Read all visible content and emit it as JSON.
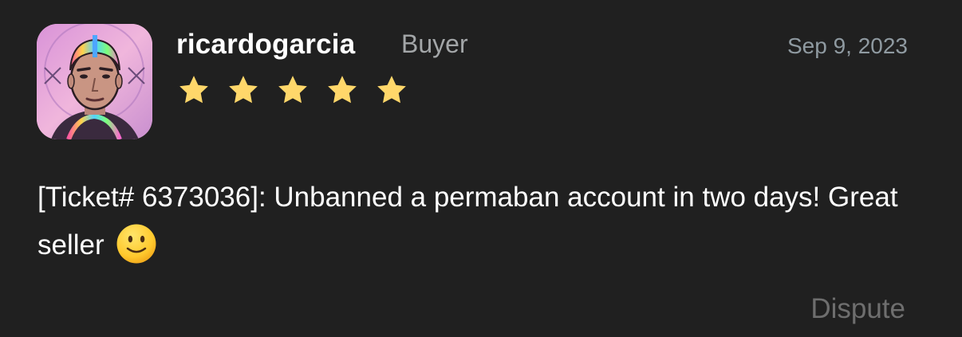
{
  "review": {
    "username": "ricardogarcia",
    "role": "Buyer",
    "date": "Sep 9, 2023",
    "rating": 5,
    "rating_max": 5,
    "text": "[Ticket# 6373036]: Unbanned a permaban account in two days! Great seller",
    "emoji_icon": "slightly-smiling-face-icon",
    "dispute_label": "Dispute"
  },
  "colors": {
    "background": "#202020",
    "star": "#ffd76a",
    "role": "#a3a6a8",
    "date": "#8f9aa1",
    "dispute": "#6e6e6e"
  }
}
